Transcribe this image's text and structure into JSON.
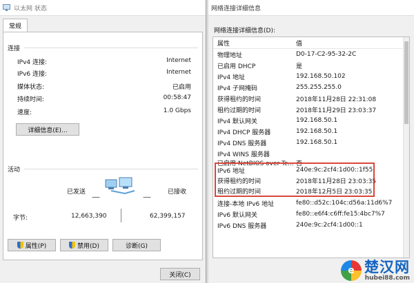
{
  "left_window": {
    "title": "以太网 状态",
    "tab": "常规",
    "connection": {
      "section_title": "连接",
      "rows": [
        {
          "label": "IPv4 连接:",
          "value": "Internet"
        },
        {
          "label": "IPv6 连接:",
          "value": "Internet"
        },
        {
          "label": "媒体状态:",
          "value": "已启用"
        },
        {
          "label": "持续时间:",
          "value": "00:58:47"
        },
        {
          "label": "速度:",
          "value": "1.0 Gbps"
        }
      ],
      "details_button": "详细信息(E)..."
    },
    "activity": {
      "section_title": "活动",
      "sent_label": "已发送",
      "received_label": "已接收",
      "bytes_label": "字节:",
      "bytes_sent": "12,663,390",
      "bytes_received": "62,399,157"
    },
    "buttons": {
      "properties": "属性(P)",
      "disable": "禁用(D)",
      "diagnose": "诊断(G)",
      "close": "关闭(C)"
    }
  },
  "right_window": {
    "title": "网络连接详细信息",
    "details_label": "网络连接详细信息(D):",
    "columns": {
      "property": "属性",
      "value": "值"
    },
    "rows": [
      {
        "property": "物理地址",
        "value": "D0-17-C2-95-32-2C"
      },
      {
        "property": "已启用 DHCP",
        "value": "是"
      },
      {
        "property": "IPv4 地址",
        "value": "192.168.50.102"
      },
      {
        "property": "IPv4 子网掩码",
        "value": "255.255.255.0"
      },
      {
        "property": "获得租约的时间",
        "value": "2018年11月28日 22:31:08"
      },
      {
        "property": "租约过期的时间",
        "value": "2018年11月29日 23:03:37"
      },
      {
        "property": "IPv4 默认网关",
        "value": "192.168.50.1"
      },
      {
        "property": "IPv4 DHCP 服务器",
        "value": "192.168.50.1"
      },
      {
        "property": "IPv4 DNS 服务器",
        "value": "192.168.50.1"
      },
      {
        "property": "IPv4 WINS 服务器",
        "value": ""
      },
      {
        "property": "已启用 NetBIOS over Tc...",
        "value": "否"
      },
      {
        "property": "IPv6 地址",
        "value": "240e:9c:2cf4:1d00::1f55"
      },
      {
        "property": "获得租约的时间",
        "value": "2018年11月28日 23:03:35"
      },
      {
        "property": "租约过期的时间",
        "value": "2018年12月5日 23:03:35"
      },
      {
        "property": "连接-本地 IPv6 地址",
        "value": "fe80::d52c:104c:d56a:11d6%7"
      },
      {
        "property": "IPv6 默认网关",
        "value": "fe80::e6f4:c6ff:fe15:4bc7%7"
      },
      {
        "property": "IPv6 DNS 服务器",
        "value": "240e:9c:2cf4:1d00::1"
      }
    ]
  },
  "watermark": {
    "brand": "楚汉网",
    "url": "hubei88.com"
  },
  "colors": {
    "highlight_box": "#d9453a",
    "watermark_blue": "#1565c0"
  }
}
